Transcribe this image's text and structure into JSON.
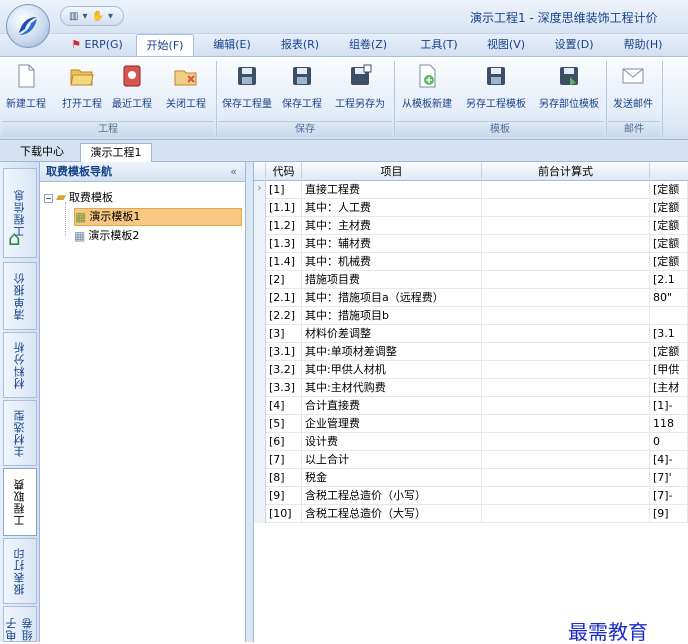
{
  "window": {
    "title": "演示工程1 - 深度思维装饰工程计价"
  },
  "qat": {
    "undo_label": "▾",
    "sep": "|",
    "more": "▾"
  },
  "menu": {
    "erp": "ERP(G)",
    "tabs": [
      "开始(F)",
      "编辑(E)",
      "报表(R)",
      "组卷(Z)",
      "工具(T)",
      "视图(V)",
      "设置(D)",
      "帮助(H)"
    ]
  },
  "ribbon": {
    "buttons": [
      "新建工程",
      "打开工程",
      "最近工程",
      "关闭工程",
      "保存工程量",
      "保存工程",
      "工程另存为",
      "从模板新建",
      "另存工程模板",
      "另存部位模板",
      "发送邮件"
    ],
    "groups": [
      "工程",
      "保存",
      "模板",
      "邮件"
    ]
  },
  "doc_tabs": [
    "下载中心",
    "演示工程1"
  ],
  "sidebar": {
    "tabs": [
      "工程信息",
      "清单报价",
      "材料分析",
      "主材选型",
      "工程取费",
      "报表打印",
      "电子组卷"
    ]
  },
  "nav": {
    "title": "取费模板导航",
    "collapse": "«",
    "root": "取费模板",
    "items": [
      "演示模板1",
      "演示模板2"
    ]
  },
  "grid": {
    "headers": [
      "代码",
      "项目",
      "前台计算式"
    ],
    "rows": [
      {
        "code": "[1]",
        "name": "直接工程费",
        "formula": "",
        "extra": "[定额"
      },
      {
        "code": "[1.1]",
        "name": "其中：人工费",
        "formula": "",
        "extra": "[定额"
      },
      {
        "code": "[1.2]",
        "name": "其中：主材费",
        "formula": "",
        "extra": "[定额"
      },
      {
        "code": "[1.3]",
        "name": "其中：辅材费",
        "formula": "",
        "extra": "[定额"
      },
      {
        "code": "[1.4]",
        "name": "其中：机械费",
        "formula": "",
        "extra": "[定额"
      },
      {
        "code": "[2]",
        "name": "措施项目费",
        "formula": "",
        "extra": "[2.1"
      },
      {
        "code": "[2.1]",
        "name": "其中：措施项目a（远程费）",
        "formula": "",
        "extra": "80\""
      },
      {
        "code": "[2.2]",
        "name": "其中：措施项目b",
        "formula": "",
        "extra": ""
      },
      {
        "code": "[3]",
        "name": "材料价差调整",
        "formula": "",
        "extra": "[3.1"
      },
      {
        "code": "[3.1]",
        "name": "其中:单项材差调整",
        "formula": "",
        "extra": "[定额"
      },
      {
        "code": "[3.2]",
        "name": "其中:甲供人材机",
        "formula": "",
        "extra": "[甲供"
      },
      {
        "code": "[3.3]",
        "name": "其中:主材代购费",
        "formula": "",
        "extra": "[主材"
      },
      {
        "code": "[4]",
        "name": "合计直接费",
        "formula": "",
        "extra": "[1]-"
      },
      {
        "code": "[5]",
        "name": "企业管理费",
        "formula": "",
        "extra": "118"
      },
      {
        "code": "[6]",
        "name": "设计费",
        "formula": "",
        "extra": "0"
      },
      {
        "code": "[7]",
        "name": "以上合计",
        "formula": "",
        "extra": "[4]-"
      },
      {
        "code": "[8]",
        "name": "税金",
        "formula": "",
        "extra": "[7]'"
      },
      {
        "code": "[9]",
        "name": "含税工程总造价（小写）",
        "formula": "",
        "extra": "[7]-"
      },
      {
        "code": "[10]",
        "name": "含税工程总造价（大写）",
        "formula": "",
        "extra": "[9]"
      }
    ]
  },
  "watermark": "最需教育",
  "colors": {
    "accent": "#15428b",
    "selected": "#f9c784"
  }
}
